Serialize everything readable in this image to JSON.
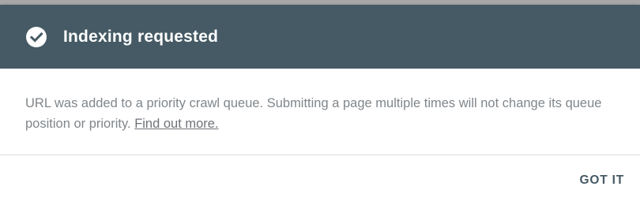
{
  "dialog": {
    "title": "Indexing requested",
    "title_icon": "check-circle-icon",
    "message_text": "URL was added to a priority crawl queue. Submitting a page multiple times will not change its queue position or priority.",
    "link_text": "Find out more.",
    "action_label": "GOT IT"
  },
  "colors": {
    "header_background": "#455a64",
    "header_text": "#ffffff",
    "body_text": "#80868b",
    "action_text": "#455a64"
  }
}
